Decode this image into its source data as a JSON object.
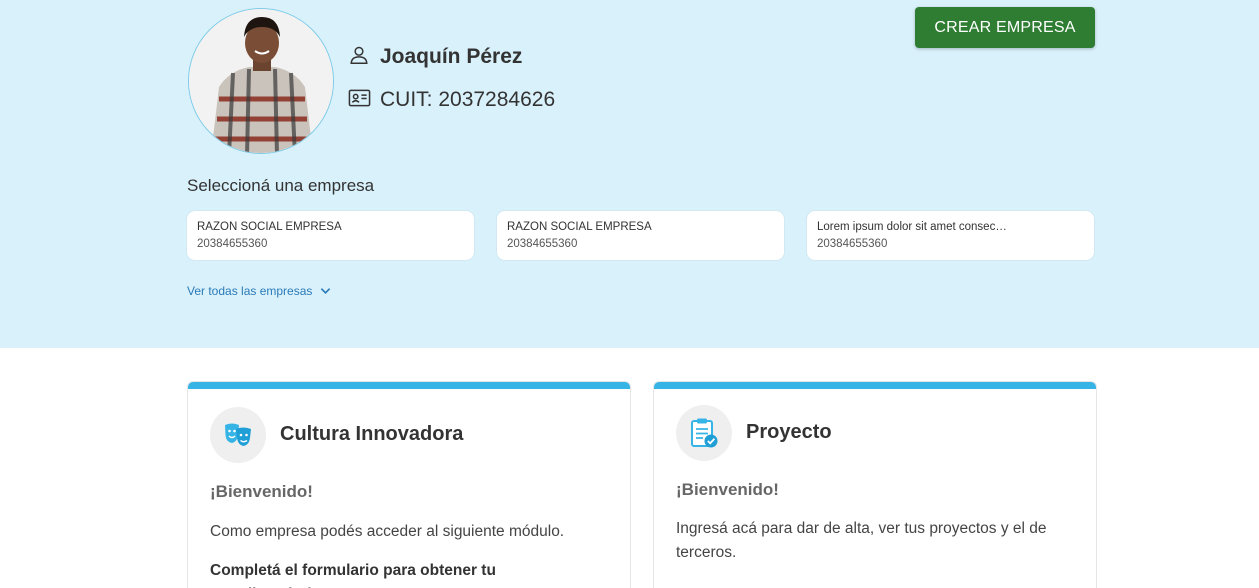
{
  "user": {
    "name": "Joaquín Pérez",
    "cuit": "CUIT: 2037284626"
  },
  "actions": {
    "create_company": "CREAR EMPRESA"
  },
  "companies": {
    "title": "Seleccioná una empresa",
    "items": [
      {
        "name": "RAZON SOCIAL EMPRESA",
        "cuit": "20384655360"
      },
      {
        "name": "RAZON SOCIAL EMPRESA",
        "cuit": "20384655360"
      },
      {
        "name": "Lorem ipsum dolor sit amet consectetur adipiscing",
        "cuit": "20384655360"
      }
    ],
    "see_all": "Ver todas las empresas"
  },
  "modules": [
    {
      "title": "Cultura Innovadora",
      "welcome": "¡Bienvenido!",
      "description": "Como empresa podés acceder al siguiente módulo.",
      "cta": "Completá el formulario para obtener tu autodiagnóstico"
    },
    {
      "title": "Proyecto",
      "welcome": "¡Bienvenido!",
      "description": "Ingresá acá para dar de alta, ver tus proyectos y el de terceros."
    }
  ],
  "colors": {
    "hero_background": "#d9f1fb",
    "primary_button": "#2e7d32",
    "accent": "#37b4e6",
    "link": "#2a7ab8"
  },
  "icons": {
    "user": "person-icon",
    "cuit": "id-card-icon",
    "see_all": "chevron-down-icon",
    "module_1": "theater-masks-icon",
    "module_2": "clipboard-check-icon"
  }
}
